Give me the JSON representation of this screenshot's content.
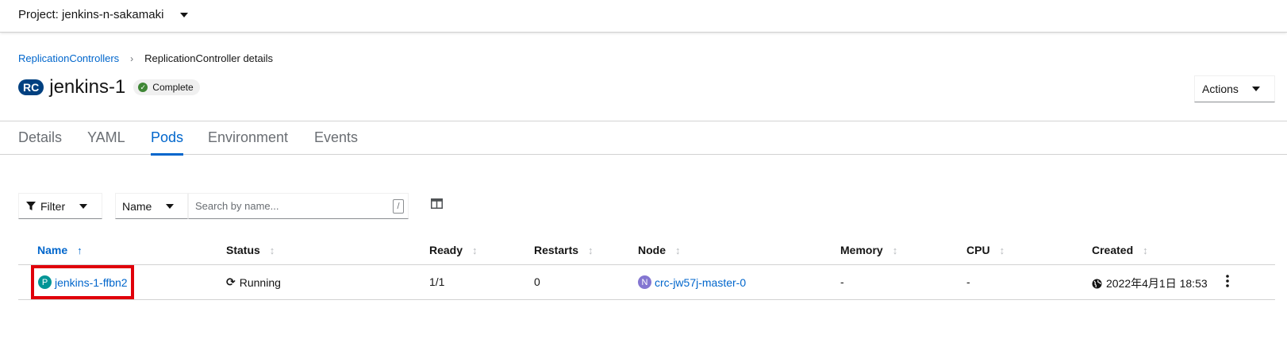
{
  "project": {
    "label": "Project: jenkins-n-sakamaki"
  },
  "breadcrumb": {
    "parent": "ReplicationControllers",
    "current": "ReplicationController details"
  },
  "resource": {
    "badge": "RC",
    "name": "jenkins-1",
    "status": "Complete"
  },
  "actions": {
    "label": "Actions"
  },
  "tabs": [
    {
      "label": "Details"
    },
    {
      "label": "YAML"
    },
    {
      "label": "Pods",
      "active": true
    },
    {
      "label": "Environment"
    },
    {
      "label": "Events"
    }
  ],
  "toolbar": {
    "filter_label": "Filter",
    "name_dropdown": "Name",
    "search_placeholder": "Search by name...",
    "search_hotkey": "/"
  },
  "table": {
    "columns": [
      "Name",
      "Status",
      "Ready",
      "Restarts",
      "Node",
      "Memory",
      "CPU",
      "Created"
    ],
    "rows": [
      {
        "name_badge": "P",
        "name": "jenkins-1-ffbn2",
        "status": "Running",
        "ready": "1/1",
        "restarts": "0",
        "node_badge": "N",
        "node": "crc-jw57j-master-0",
        "memory": "-",
        "cpu": "-",
        "created": "2022年4月1日 18:53"
      }
    ]
  },
  "colors": {
    "link": "#0066cc",
    "highlight": "#e0000a",
    "pod_badge": "#009596",
    "node_badge": "#8476d1",
    "rc_badge": "#004080"
  }
}
